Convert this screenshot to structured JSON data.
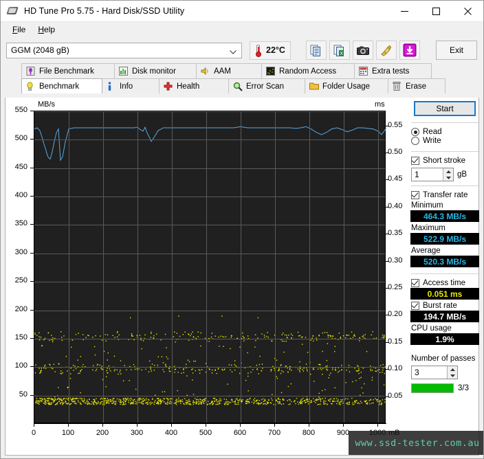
{
  "window": {
    "title": "HD Tune Pro 5.75 - Hard Disk/SSD Utility",
    "app_icon": "hard-disk-icon",
    "minimize": "–",
    "maximize": "□",
    "close": "✕"
  },
  "menu": {
    "items": [
      {
        "label": "File",
        "accel": "F"
      },
      {
        "label": "Help",
        "accel": "H"
      }
    ]
  },
  "toolbar": {
    "drive_value": "GGM (2048 gB)",
    "drive_options": [
      "GGM (2048 gB)"
    ],
    "temperature": "22°C",
    "thermometer_icon": "thermometer-icon",
    "buttons": [
      {
        "name": "copy-icon",
        "label": ""
      },
      {
        "name": "copy-excel-icon",
        "label": ""
      },
      {
        "name": "camera-icon",
        "label": ""
      },
      {
        "name": "broom-icon",
        "label": ""
      },
      {
        "name": "download-icon",
        "label": ""
      }
    ],
    "exit_label": "Exit"
  },
  "tabs": {
    "top_row": [
      {
        "label": "File Benchmark",
        "icon": "file-benchmark-icon",
        "selected": false
      },
      {
        "label": "Disk monitor",
        "icon": "disk-monitor-icon",
        "selected": false
      },
      {
        "label": "AAM",
        "icon": "speaker-icon",
        "selected": false
      },
      {
        "label": "Random Access",
        "icon": "random-access-icon",
        "selected": false
      },
      {
        "label": "Extra tests",
        "icon": "extra-tests-icon",
        "selected": false
      }
    ],
    "bottom_row": [
      {
        "label": "Benchmark",
        "icon": "lightbulb-icon",
        "selected": true
      },
      {
        "label": "Info",
        "icon": "info-icon",
        "selected": false
      },
      {
        "label": "Health",
        "icon": "health-cross-icon",
        "selected": false
      },
      {
        "label": "Error Scan",
        "icon": "magnifier-icon",
        "selected": false
      },
      {
        "label": "Folder Usage",
        "icon": "folder-icon",
        "selected": false
      },
      {
        "label": "Erase",
        "icon": "trash-icon",
        "selected": false
      }
    ]
  },
  "panel": {
    "start_label": "Start",
    "mode": {
      "read_label": "Read",
      "write_label": "Write",
      "selected": "Read"
    },
    "short_stroke": {
      "label": "Short stroke",
      "checked": true,
      "value": "1",
      "unit": "gB"
    },
    "transfer_rate": {
      "label": "Transfer rate",
      "checked": true
    },
    "minimum_label": "Minimum",
    "minimum_value": "464.3 MB/s",
    "maximum_label": "Maximum",
    "maximum_value": "522.9 MB/s",
    "average_label": "Average",
    "average_value": "520.3 MB/s",
    "access_time": {
      "label": "Access time",
      "checked": true,
      "value": "0.051 ms"
    },
    "burst_rate": {
      "label": "Burst rate",
      "checked": true,
      "value": "194.7 MB/s"
    },
    "cpu_usage_label": "CPU usage",
    "cpu_usage_value": "1.9%",
    "passes_label": "Number of passes",
    "passes_value": "3",
    "progress_text": "3/3",
    "progress_percent": 100,
    "colors": {
      "accent": "#1879c8",
      "value_cyan": "#29b8e8",
      "value_yellow": "#e8e800",
      "progress_green": "#00bb00"
    }
  },
  "watermark": "www.ssd-tester.com.au",
  "chart_data": {
    "type": "line",
    "title": "",
    "ylabel": "MB/s",
    "y2label": "ms",
    "xlabel": "mB",
    "ylim": [
      0,
      550
    ],
    "y2lim": [
      0,
      0.5775
    ],
    "xlim": [
      0,
      1024
    ],
    "grid": true,
    "y_ticks": [
      50,
      100,
      150,
      200,
      250,
      300,
      350,
      400,
      450,
      500,
      550
    ],
    "y2_ticks": [
      0.05,
      0.1,
      0.15,
      0.2,
      0.25,
      0.3,
      0.35,
      0.4,
      0.45,
      0.5,
      0.55
    ],
    "x_ticks": [
      0,
      100,
      200,
      300,
      400,
      500,
      600,
      700,
      800,
      900,
      1000
    ],
    "series": [
      {
        "name": "Transfer rate",
        "type": "line",
        "color": "#5aa8e0",
        "axis": "left",
        "x": [
          0,
          8,
          16,
          22,
          28,
          34,
          38,
          42,
          46,
          52,
          58,
          64,
          70,
          76,
          82,
          90,
          100,
          115,
          130,
          150,
          170,
          190,
          210,
          230,
          250,
          270,
          290,
          300,
          308,
          316,
          322,
          328,
          334,
          340,
          350,
          360,
          375,
          390,
          405,
          420,
          440,
          460,
          480,
          500,
          520,
          540,
          560,
          580,
          600,
          620,
          640,
          660,
          680,
          700,
          715,
          730,
          745,
          760,
          775,
          790,
          805,
          820,
          835,
          850,
          865,
          880,
          895,
          910,
          925,
          940,
          955,
          970,
          985,
          1000,
          1010,
          1020,
          1024
        ],
        "y": [
          519,
          521,
          516,
          505,
          492,
          481,
          472,
          468,
          466,
          479,
          497,
          512,
          519,
          464,
          470,
          496,
          519,
          521,
          521,
          521,
          521,
          521,
          521,
          521,
          521,
          521,
          521,
          522,
          518,
          515,
          522,
          512,
          505,
          497,
          506,
          516,
          521,
          521,
          521,
          521,
          521,
          521,
          521,
          521,
          521,
          521,
          521,
          521,
          523,
          521,
          521,
          521,
          521,
          521,
          521,
          521,
          521,
          520,
          521,
          523,
          519,
          513,
          509,
          513,
          519,
          521,
          518,
          514,
          517,
          521,
          521,
          520,
          519,
          515,
          509,
          517,
          521
        ]
      },
      {
        "name": "Access time",
        "type": "scatter",
        "color": "#e8e800",
        "axis": "right",
        "note": "Dense baseline band near 0.04 ms spanning the whole drive, with sparse outlier clusters near 0.10 ms and 0.16 ms, and isolated points up to 0.20 ms.",
        "baseline_ms": 0.042,
        "cluster_ms": [
          0.1,
          0.105,
          0.16,
          0.165
        ],
        "outliers_ms": [
          0.197,
          0.2,
          0.145,
          0.125,
          0.075,
          0.085
        ]
      }
    ]
  }
}
